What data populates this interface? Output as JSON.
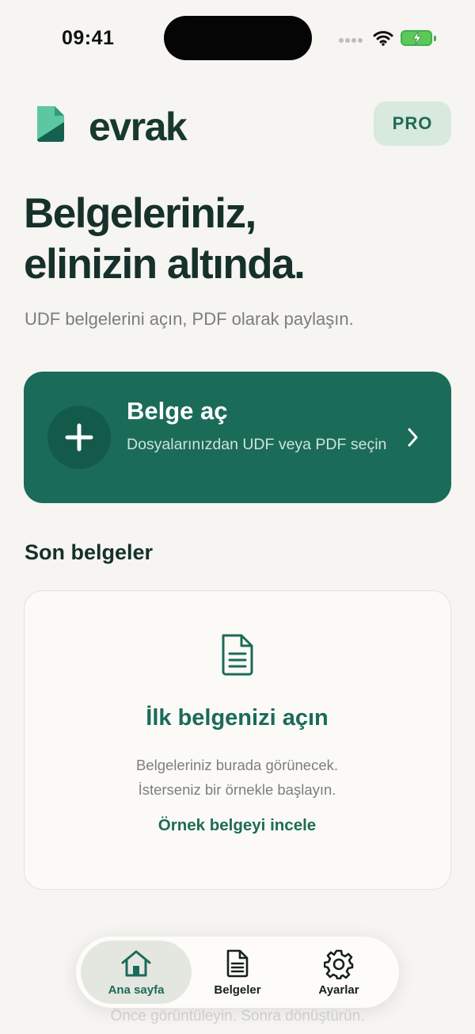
{
  "status_bar": {
    "time": "09:41"
  },
  "header": {
    "brand": "evrak",
    "pro_label": "PRO"
  },
  "hero": {
    "title_line1": "Belgeleriniz,",
    "title_line2": "elinizin altında.",
    "subtitle": "UDF belgelerini açın, PDF olarak paylaşın."
  },
  "open_card": {
    "title": "Belge aç",
    "description": "Dosyalarınızdan UDF veya PDF seçin"
  },
  "recent": {
    "section_title": "Son belgeler",
    "empty_title": "İlk belgenizi açın",
    "empty_line1": "Belgeleriniz burada görünecek.",
    "empty_line2": "İsterseniz bir örnekle başlayın.",
    "sample_link": "Örnek belgeyi incele"
  },
  "tab_bar": {
    "tabs": [
      {
        "label": "Ana sayfa",
        "icon": "home-icon",
        "active": true
      },
      {
        "label": "Belgeler",
        "icon": "document-icon",
        "active": false
      },
      {
        "label": "Ayarlar",
        "icon": "gear-icon",
        "active": false
      }
    ]
  },
  "footer_hint": "Önce görüntüleyin. Sonra dönüştürün.",
  "colors": {
    "background": "#f6f5f1",
    "accent": "#1b6b59",
    "text_primary": "#16302a",
    "text_secondary": "#7b7e79"
  }
}
